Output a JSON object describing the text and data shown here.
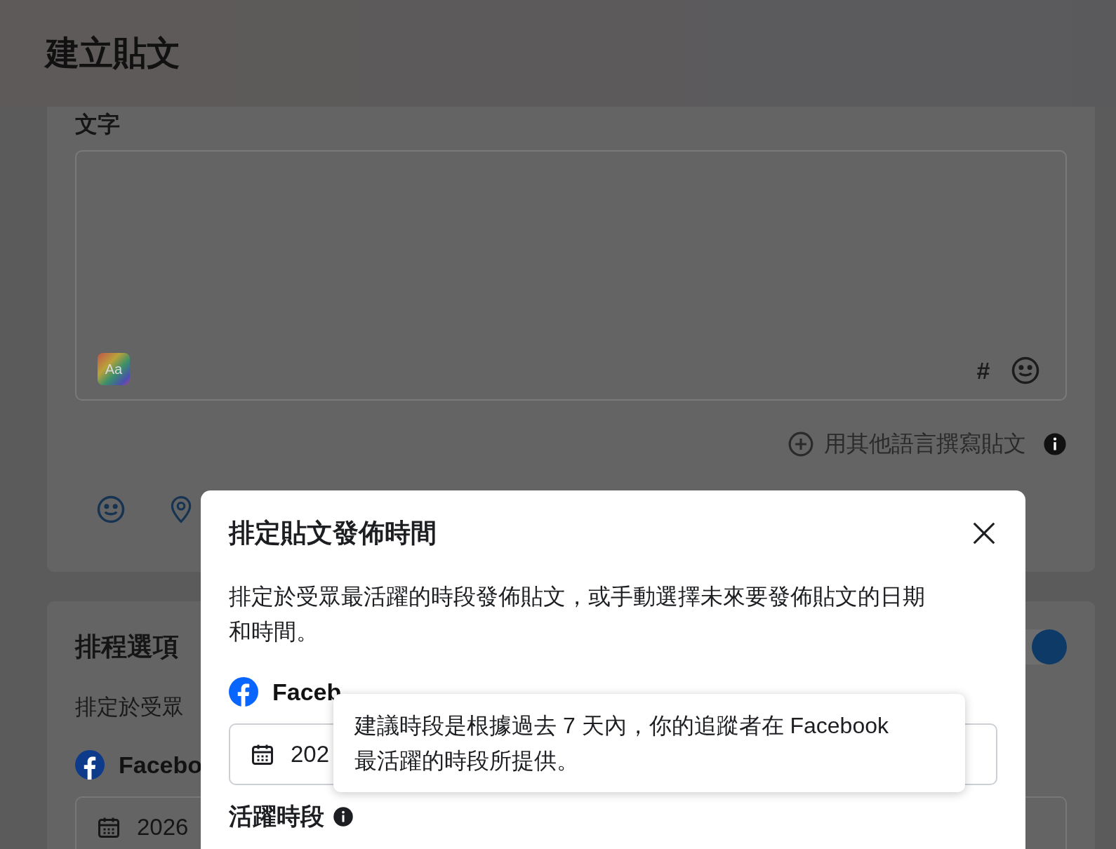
{
  "header": {
    "title": "建立貼文"
  },
  "text_card": {
    "label": "文字",
    "style_button": "Aa",
    "hashtag_button": "#",
    "other_language_link": "用其他語言撰寫貼文"
  },
  "schedule_card": {
    "title": "排程選項",
    "toggle": {
      "on": true
    },
    "description": "排定於受眾",
    "account": "Facebo",
    "date": "2026"
  },
  "dialog": {
    "title": "排定貼文發佈時間",
    "description": "排定於受眾最活躍的時段發佈貼文，或手動選擇未來要發佈貼文的日期和時間。",
    "account": "Faceb",
    "date": "202",
    "section_title": "活躍時段"
  },
  "tooltip": {
    "text": "建議時段是根據過去 7 天內，你的追蹤者在 Facebook\n最活躍的時段所提供。"
  }
}
